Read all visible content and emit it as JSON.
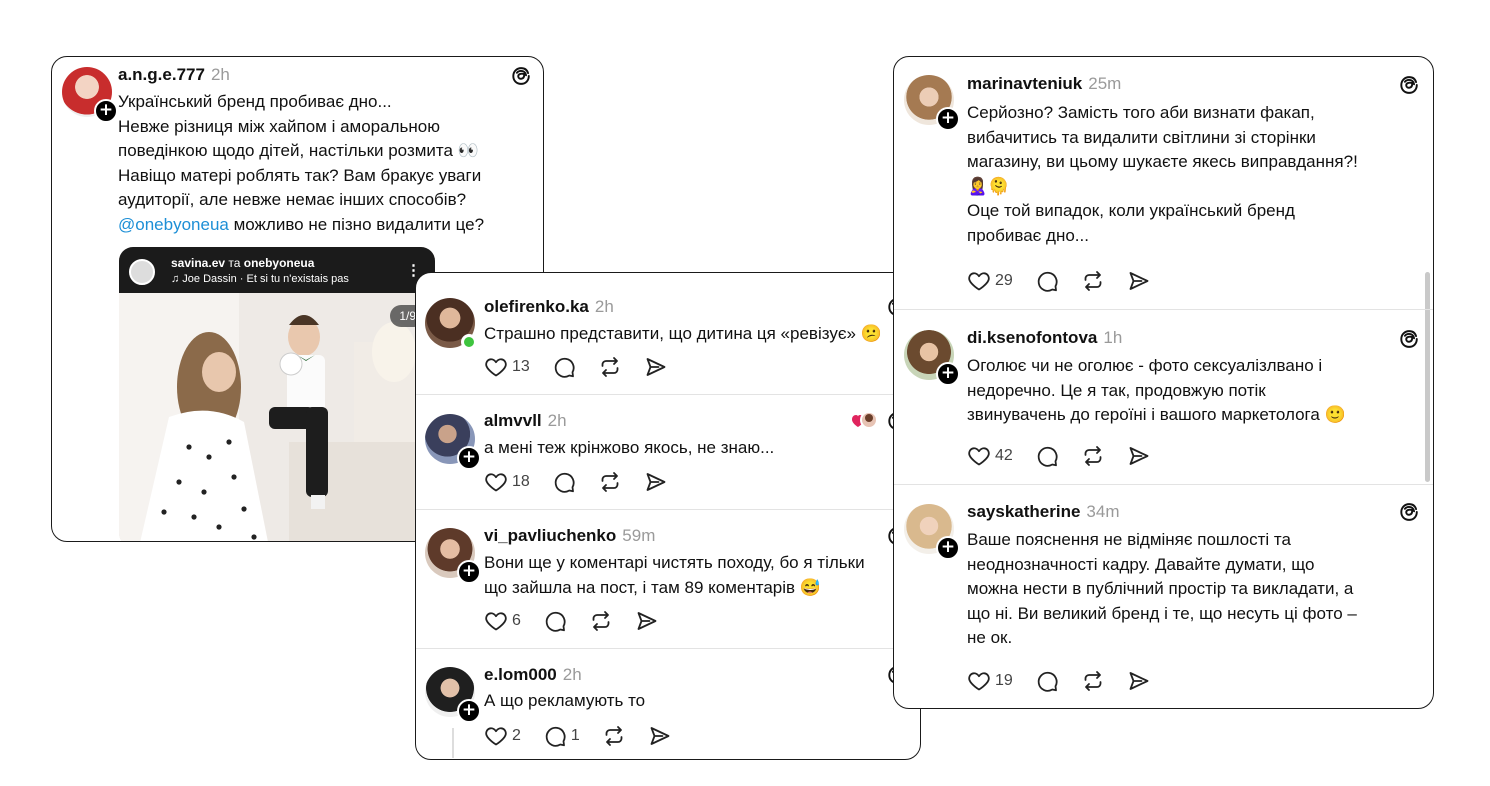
{
  "main_post": {
    "username": "a.n.g.e.777",
    "time": "2h",
    "lines": [
      "Український бренд пробиває дно...",
      "Невже різниця між хайпом і аморальною",
      "поведінкою щодо дітей, настільки розмита 👀",
      "Навіщо матері роблять так? Вам бракує уваги",
      "аудиторії, але невже немає інших способів?"
    ],
    "mention": "@onebyoneua",
    "mention_rest": " можливо не пізно видалити це?",
    "media": {
      "accounts": "savina.ev",
      "conj": " та ",
      "accounts2": "onebyoneua",
      "music": "♫ Joe Dassin · Et si tu n'existais pas",
      "more": "⋮",
      "counter": "1/9"
    }
  },
  "middle_replies": [
    {
      "username": "olefirenko.ka",
      "time": "2h",
      "text": [
        "Страшно представити, що дитина ця «ревізує» 😕"
      ],
      "likes": "13",
      "replies": ""
    },
    {
      "username": "almvvll",
      "time": "2h",
      "text": [
        "а мені теж крінжово якось, не знаю..."
      ],
      "likes": "18",
      "replies": ""
    },
    {
      "username": "vi_pavliuchenko",
      "time": "59m",
      "text": [
        "Вони ще у коментарі чистять походу, бо я тільки",
        "що зайшла на пост, і там 89 коментарів 😅"
      ],
      "likes": "6",
      "replies": ""
    },
    {
      "username": "e.lom000",
      "time": "2h",
      "text": [
        "А що рекламують то"
      ],
      "likes": "2",
      "replies": "1"
    }
  ],
  "right_replies": [
    {
      "username": "marinavteniuk",
      "time": "25m",
      "text": [
        "Серйозно? Замість того аби визнати факап,",
        "вибачитись та видалити світлини зі сторінки",
        "магазину, ви цьому шукаєте якесь виправдання?!",
        "🙎‍♀️🫠",
        "Оце той випадок, коли український бренд",
        "пробиває дно..."
      ],
      "likes": "29"
    },
    {
      "username": "di.ksenofontova",
      "time": "1h",
      "text": [
        "Оголює чи не оголює - фото сексуалізлвано і",
        "недоречно. Це я так, продовжую потік",
        "звинувачень до героїні і вашого маркетолога 🙂"
      ],
      "likes": "42"
    },
    {
      "username": "sayskatherine",
      "time": "34m",
      "text": [
        "Ваше пояснення не відміняє пошлості та",
        "неоднозначності кадру. Давайте думати, що",
        "можна нести в публічний простір та викладати, а",
        "що ні. Ви великий бренд і те, що несуть ці фото –",
        "не ок."
      ],
      "likes": "19"
    }
  ],
  "icons": {
    "like": "heart-icon",
    "comment": "comment-icon",
    "repost": "repost-icon",
    "share": "share-icon",
    "brand": "threads-logo-icon",
    "follow": "plus-icon"
  },
  "colors": {
    "mention": "#1d8fd6",
    "online": "#3ec43e",
    "time_text": "#9a9a9a"
  }
}
